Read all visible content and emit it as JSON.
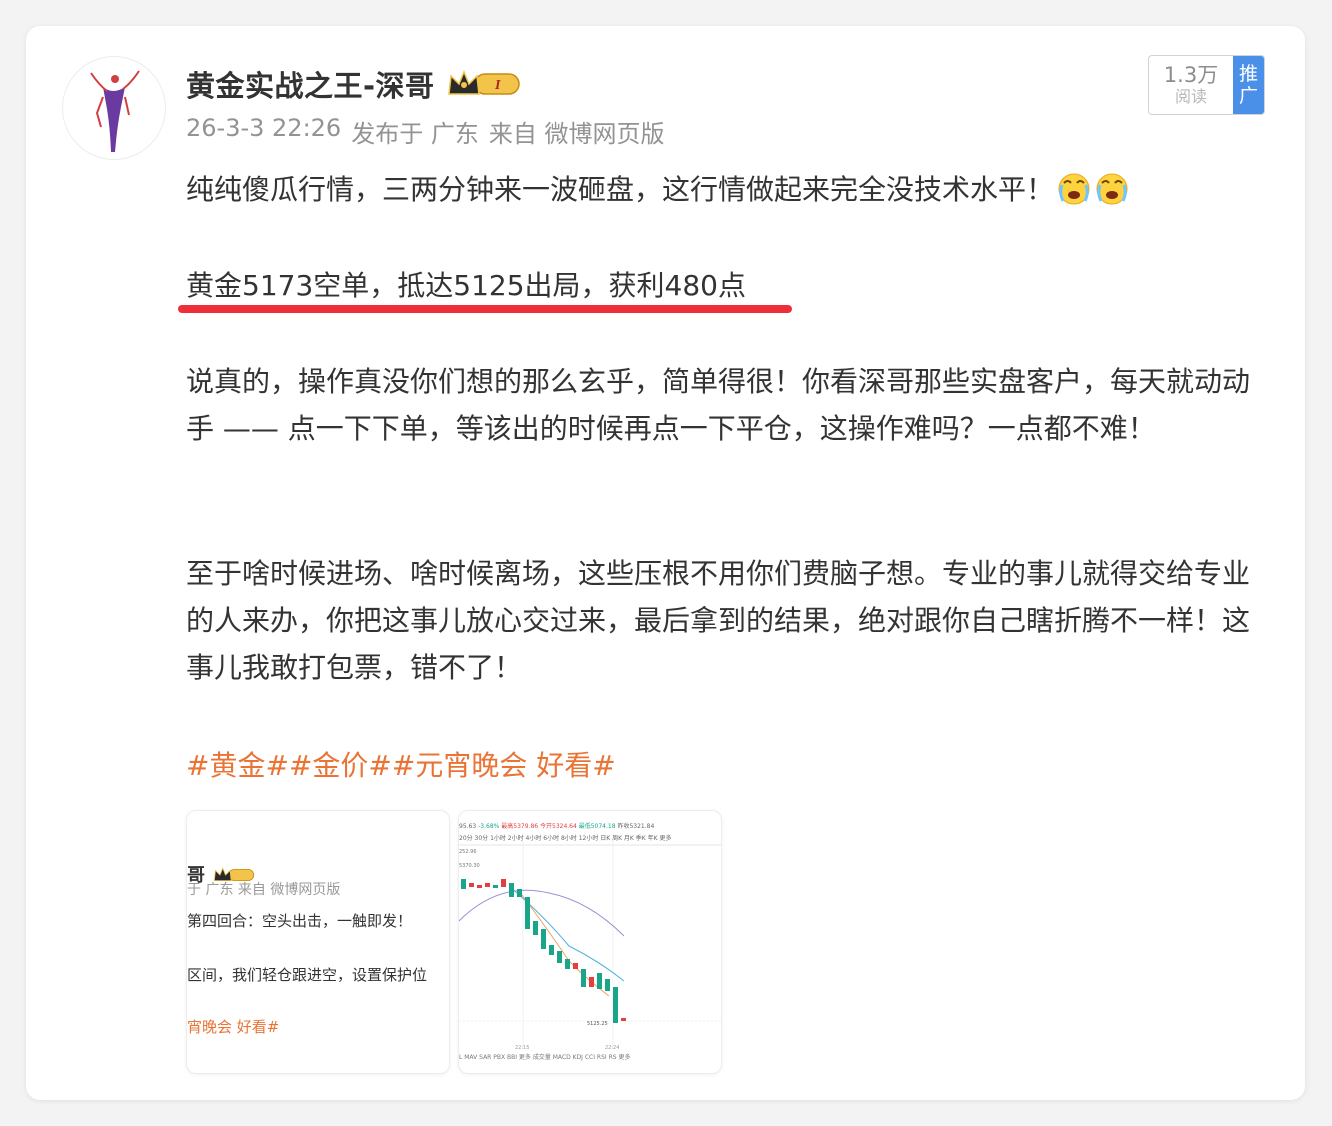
{
  "author": {
    "name": "黄金实战之王-深哥",
    "badge_text": "I"
  },
  "meta": {
    "time": "26-3-3 22:26",
    "location": "发布于 广东",
    "source": "来自 微博网页版"
  },
  "stats": {
    "read_count": "1.3万",
    "read_label": "阅读",
    "promote_line1": "推",
    "promote_line2": "广"
  },
  "post": {
    "line1": "纯纯傻瓜行情，三两分钟来一波砸盘，这行情做起来完全没技术水平！",
    "line2": "黄金5173空单，抵达5125出局，获利480点",
    "para3": "说真的，操作真没你们想的那么玄乎，简单得很！你看深哥那些实盘客户，每天就动动手 —— 点一下下单，等该出的时候再点一下平仓，这操作难吗？一点都不难！",
    "para4": "至于啥时候进场、啥时候离场，这些压根不用你们费脑子想。专业的事儿就得交给专业的人来办，你把这事儿放心交过来，最后拿到的结果，绝对跟你自己瞎折腾不一样！这事儿我敢打包票，错不了！",
    "emoji": "crying-face-icon",
    "underline_color": "#ee2f3a"
  },
  "hashtags": [
    "#黄金#",
    "#金价#",
    "#元宵晚会 好看#"
  ],
  "hashtag_color": "#e97436",
  "thumb1": {
    "name": "哥",
    "meta": "于 广东  来自 微博网页版",
    "line_a": "第四回合：空头出击，一触即发！",
    "line_b": "区间，我们轻仓跟进空，设置保护位",
    "tag": "宵晚会 好看#"
  },
  "thumb2": {
    "price": "95.63",
    "pct": "-3.68%",
    "high": "最高5379.86",
    "low": "最低5074.18",
    "open": "今开5324.64",
    "prev": "昨收5321.84",
    "periods": "20分 30分 1小时 2小时 4小时 6小时 8小时 12小时 日K 周K 月K 季K 年K 更多",
    "level_a": "252.96",
    "level_b": "5370.30",
    "last": "5125.25",
    "time_a": "22:15",
    "time_b": "22:24",
    "bottom": "L MAV SAR PBX BBI 更多    成交量 MACD KDJ CCI RSI RS 更多"
  }
}
